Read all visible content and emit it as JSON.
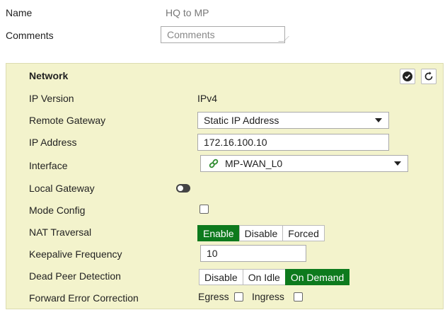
{
  "top": {
    "name_label": "Name",
    "name_value": "HQ to MP",
    "comments_label": "Comments",
    "comments_placeholder": "Comments"
  },
  "network": {
    "title": "Network",
    "ip_version": {
      "label": "IP Version",
      "value": "IPv4"
    },
    "remote_gateway": {
      "label": "Remote Gateway",
      "value": "Static IP Address"
    },
    "ip_address": {
      "label": "IP Address",
      "value": "172.16.100.10"
    },
    "interface": {
      "label": "Interface",
      "value": "MP-WAN_L0",
      "icon": "link-icon"
    },
    "local_gateway": {
      "label": "Local Gateway",
      "enabled": false
    },
    "mode_config": {
      "label": "Mode Config",
      "checked": false
    },
    "nat_traversal": {
      "label": "NAT Traversal",
      "options": [
        "Enable",
        "Disable",
        "Forced"
      ],
      "selected": "Enable"
    },
    "keepalive": {
      "label": "Keepalive Frequency",
      "value": "10"
    },
    "dpd": {
      "label": "Dead Peer Detection",
      "options": [
        "Disable",
        "On Idle",
        "On Demand"
      ],
      "selected": "On Demand"
    },
    "fec": {
      "label": "Forward Error Correction",
      "egress_label": "Egress",
      "ingress_label": "Ingress",
      "egress_checked": false,
      "ingress_checked": false
    }
  },
  "colors": {
    "panel_bg": "#f3f3cc",
    "active_green": "#0d7a1d"
  }
}
